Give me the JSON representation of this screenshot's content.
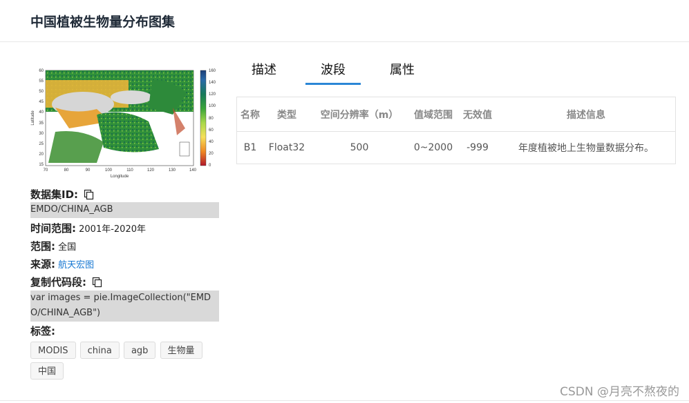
{
  "page": {
    "title": "中国植被生物量分布图集"
  },
  "map": {
    "y_ticks": [
      "60",
      "55",
      "50",
      "45",
      "40",
      "35",
      "30",
      "25",
      "20",
      "15"
    ],
    "x_ticks": [
      "70",
      "80",
      "90",
      "100",
      "110",
      "120",
      "130",
      "140"
    ],
    "xlabel": "Longitude",
    "ylabel": "Latitude",
    "colorbar_ticks": [
      "160",
      "140",
      "120",
      "100",
      "80",
      "60",
      "40",
      "20",
      "0"
    ]
  },
  "info": {
    "dataset_id_label": "数据集ID:",
    "dataset_id_value": "EMDO/CHINA_AGB",
    "time_label": "时间范围:",
    "time_value": "2001年-2020年",
    "range_label": "范围:",
    "range_value": "全国",
    "source_label": "来源:",
    "source_value": "航天宏图",
    "code_label": "复制代码段:",
    "code_value": "var images = pie.ImageCollection(\"EMDO/CHINA_AGB\")",
    "tags_label": "标签:",
    "tags": [
      "MODIS",
      "china",
      "agb",
      "生物量",
      "中国"
    ]
  },
  "tabs": [
    "描述",
    "波段",
    "属性"
  ],
  "active_tab": "波段",
  "table": {
    "headers": [
      "名称",
      "类型",
      "空间分辨率（m）",
      "值域范围",
      "无效值",
      "描述信息"
    ],
    "rows": [
      [
        "B1",
        "Float32",
        "500",
        "0~2000",
        "-999",
        "年度植被地上生物量数据分布。"
      ]
    ]
  },
  "watermark": "CSDN @月亮不熬夜的",
  "colors": {
    "accent": "#2b86d6",
    "link": "#1677d2"
  }
}
